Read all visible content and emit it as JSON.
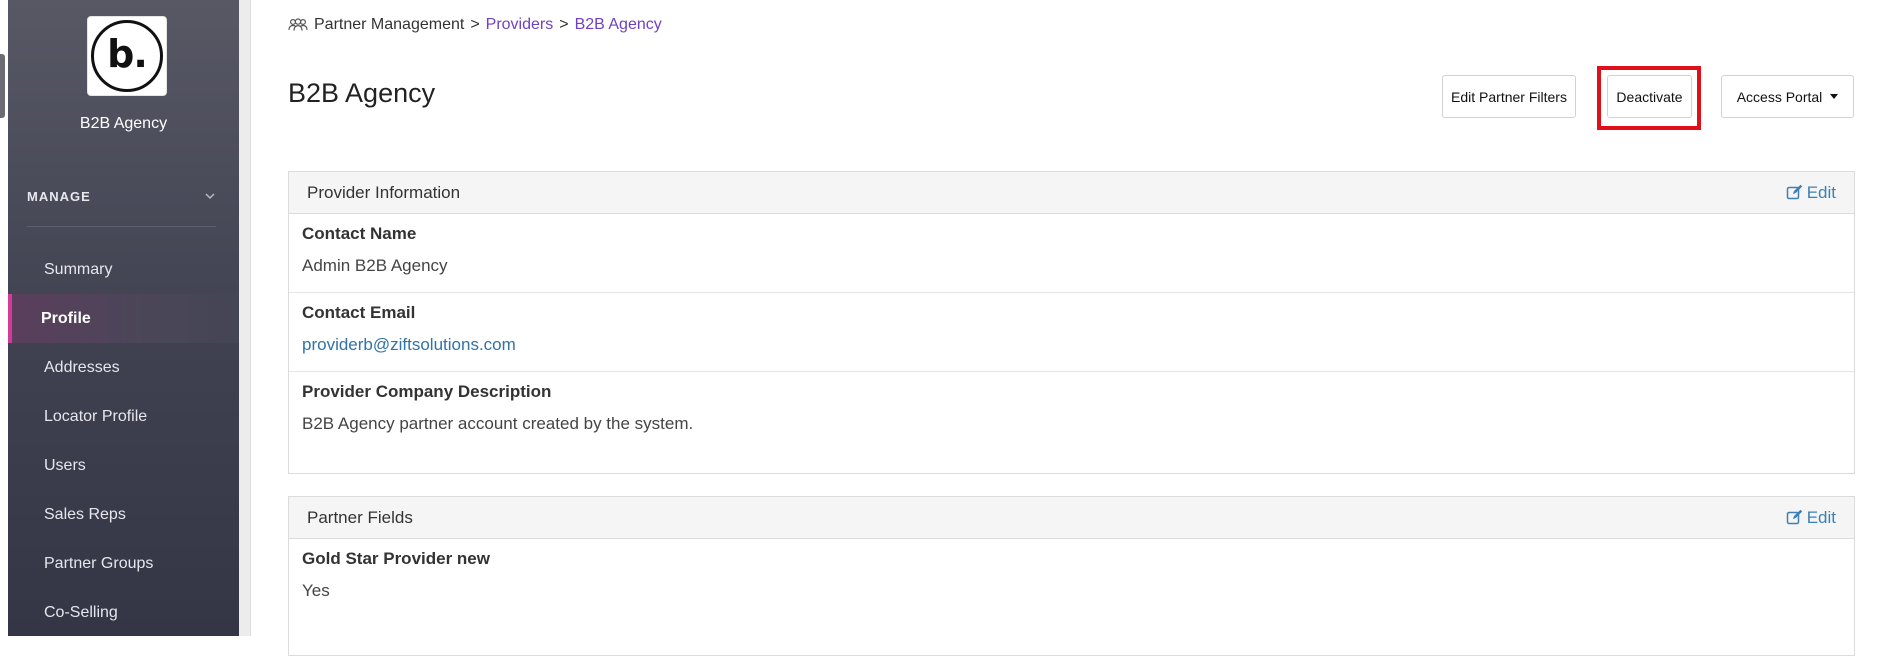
{
  "sidebar": {
    "logo_text": "b.",
    "org_name": "B2B Agency",
    "section_label": "MANAGE",
    "items": [
      {
        "label": "Summary"
      },
      {
        "label": "Profile"
      },
      {
        "label": "Addresses"
      },
      {
        "label": "Locator Profile"
      },
      {
        "label": "Users"
      },
      {
        "label": "Sales Reps"
      },
      {
        "label": "Partner Groups"
      },
      {
        "label": "Co-Selling"
      }
    ],
    "active_item": "Profile"
  },
  "breadcrumb": {
    "root": "Partner Management",
    "sep1": ">",
    "providers": "Providers",
    "sep2": ">",
    "current": "B2B Agency"
  },
  "page": {
    "title": "B2B Agency"
  },
  "toolbar": {
    "edit_filters_label": "Edit Partner Filters",
    "deactivate_label": "Deactivate",
    "access_portal_label": "Access Portal"
  },
  "provider_info": {
    "title": "Provider Information",
    "edit_label": "Edit",
    "fields": [
      {
        "label": "Contact Name",
        "value": "Admin B2B Agency"
      },
      {
        "label": "Contact Email",
        "value": "providerb@ziftsolutions.com"
      },
      {
        "label": "Provider Company Description",
        "value": "B2B Agency partner account created by the system."
      }
    ]
  },
  "partner_fields": {
    "title": "Partner Fields",
    "edit_label": "Edit",
    "fields": [
      {
        "label": "Gold Star Provider new",
        "value": "Yes"
      }
    ]
  },
  "colors": {
    "accent_purple": "#6f42c1",
    "link_blue": "#3e7fb5",
    "highlight_red": "#e0101a",
    "active_marker": "#d13c9a"
  }
}
